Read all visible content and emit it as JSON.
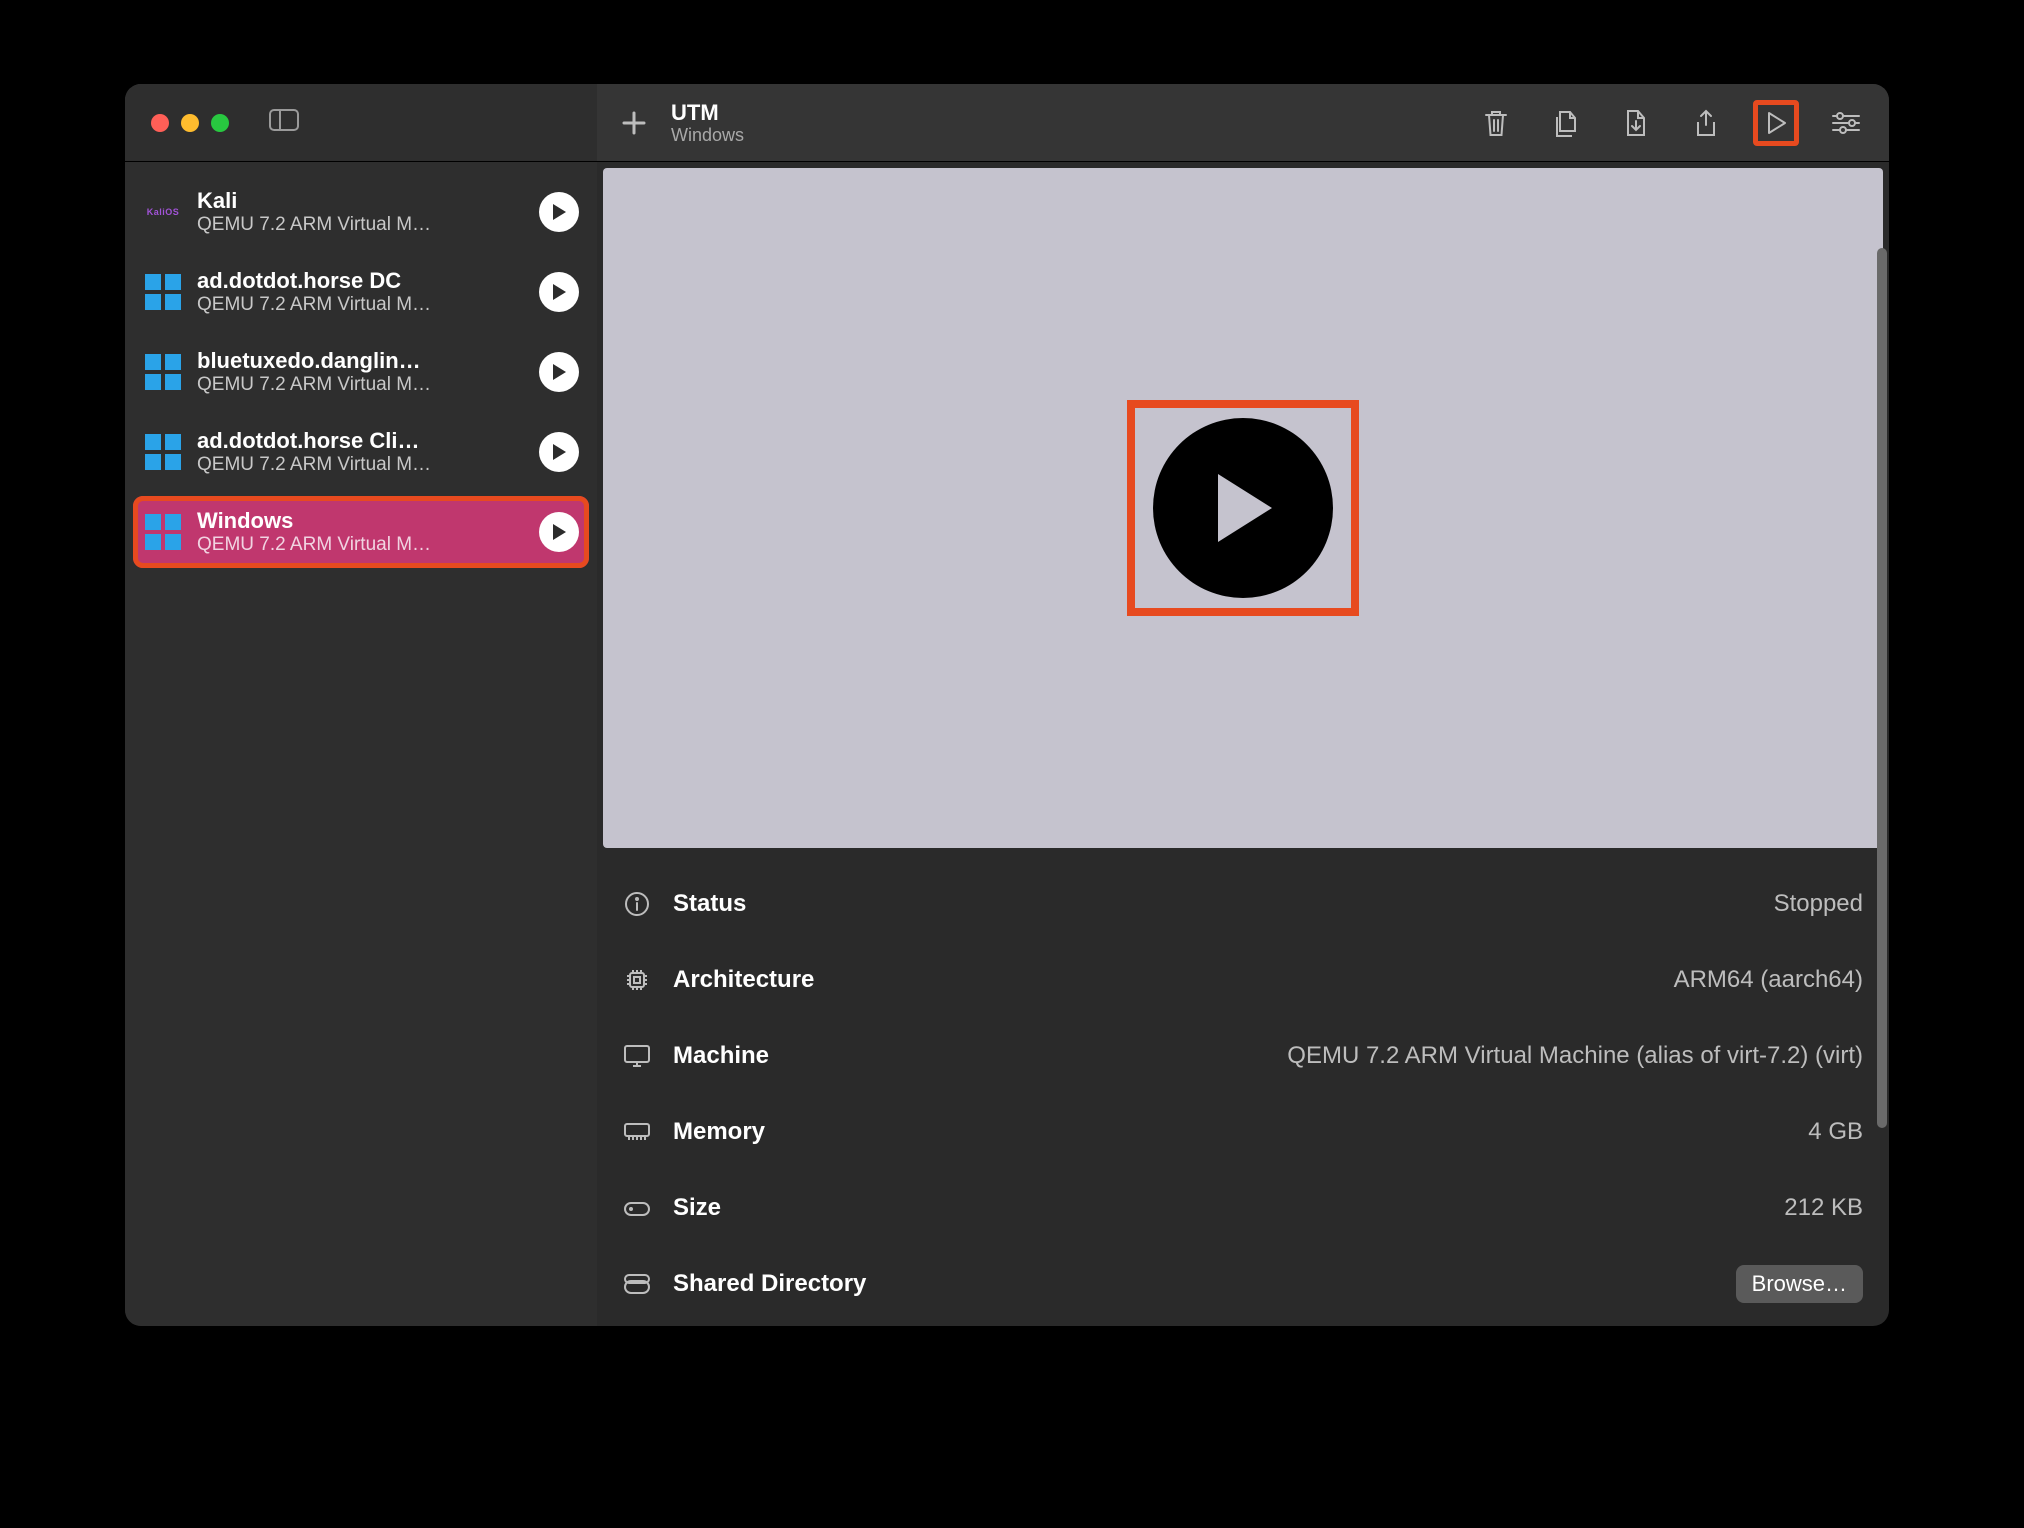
{
  "header": {
    "title": "UTM",
    "subtitle": "Windows"
  },
  "sidebar": {
    "items": [
      {
        "name": "Kali",
        "sub": "QEMU 7.2 ARM Virtual M…",
        "icon": "kali",
        "selected": false
      },
      {
        "name": "ad.dotdot.horse DC",
        "sub": "QEMU 7.2 ARM Virtual M…",
        "icon": "windows",
        "selected": false
      },
      {
        "name": "bluetuxedo.danglin…",
        "sub": "QEMU 7.2 ARM Virtual M…",
        "icon": "windows",
        "selected": false
      },
      {
        "name": "ad.dotdot.horse Cli…",
        "sub": "QEMU 7.2 ARM Virtual M…",
        "icon": "windows",
        "selected": false
      },
      {
        "name": "Windows",
        "sub": "QEMU 7.2 ARM Virtual M…",
        "icon": "windows",
        "selected": true
      }
    ]
  },
  "details": {
    "rows": [
      {
        "label": "Status",
        "value": "Stopped"
      },
      {
        "label": "Architecture",
        "value": "ARM64 (aarch64)"
      },
      {
        "label": "Machine",
        "value": "QEMU 7.2 ARM Virtual Machine (alias of virt-7.2) (virt)"
      },
      {
        "label": "Memory",
        "value": "4 GB"
      },
      {
        "label": "Size",
        "value": "212 KB"
      },
      {
        "label": "Shared Directory",
        "value": ""
      }
    ],
    "browse_label": "Browse…"
  },
  "colors": {
    "highlight": "#e74a1f",
    "selected": "#c0376e"
  }
}
